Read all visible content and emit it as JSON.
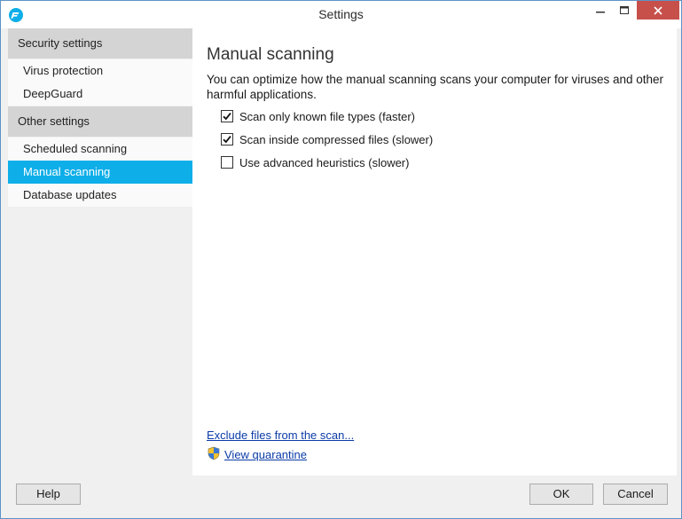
{
  "window": {
    "title": "Settings",
    "app_icon": "f-secure-shield-icon",
    "controls": [
      "minimize-icon",
      "maximize-icon",
      "close-icon"
    ]
  },
  "sidebar": {
    "sections": [
      {
        "header": "Security settings",
        "items": [
          "Virus protection",
          "DeepGuard"
        ]
      },
      {
        "header": "Other settings",
        "items": [
          "Scheduled scanning",
          "Manual scanning",
          "Database updates"
        ]
      }
    ],
    "selected": "Manual scanning"
  },
  "main": {
    "title": "Manual scanning",
    "description": "You can optimize how the manual scanning scans your computer for viruses and other harmful applications.",
    "options": [
      {
        "label": "Scan only known file types (faster)",
        "checked": true
      },
      {
        "label": "Scan inside compressed files (slower)",
        "checked": true
      },
      {
        "label": "Use advanced heuristics (slower)",
        "checked": false
      }
    ],
    "links": {
      "exclude": "Exclude files from the scan...",
      "quarantine": "View quarantine"
    }
  },
  "footer": {
    "help": "Help",
    "ok": "OK",
    "cancel": "Cancel"
  },
  "colors": {
    "accent": "#0eaee8",
    "close_button": "#c7504b",
    "link": "#0b3ba8"
  }
}
